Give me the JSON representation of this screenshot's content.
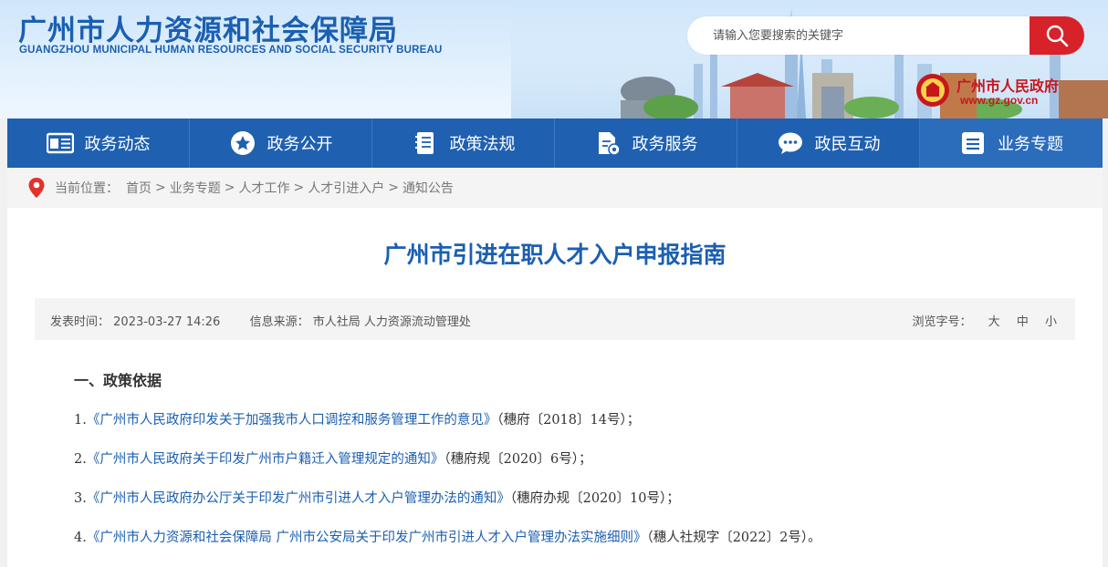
{
  "header": {
    "title": "广州市人力资源和社会保障局",
    "subtitle": "GUANGZHOU MUNICIPAL HUMAN RESOURCES AND SOCIAL SECURITY BUREAU",
    "search_placeholder": "请输入您要搜索的关键字",
    "gov_name": "广州市人民政府",
    "gov_url": "www.gz.gov.cn"
  },
  "nav": {
    "items": [
      {
        "label": "政务动态",
        "icon": "newspaper-icon"
      },
      {
        "label": "政务公开",
        "icon": "star-icon"
      },
      {
        "label": "政策法规",
        "icon": "document-icon"
      },
      {
        "label": "政务服务",
        "icon": "service-icon"
      },
      {
        "label": "政民互动",
        "icon": "chat-icon"
      },
      {
        "label": "业务专题",
        "icon": "menu-icon"
      }
    ]
  },
  "breadcrumb": {
    "prefix": "当前位置：",
    "items": [
      "首页",
      "业务专题",
      "人才工作",
      "人才引进入户",
      "通知公告"
    ]
  },
  "article": {
    "title": "广州市引进在职人才入户申报指南",
    "publish_label": "发表时间：",
    "publish_time": "2023-03-27 14:26",
    "source_label": "信息来源：",
    "source": "市人社局 人力资源流动管理处",
    "font_size_label": "浏览字号：",
    "font_sizes": [
      "大",
      "中",
      "小"
    ],
    "section_heading": "一、政策依据",
    "policies": [
      {
        "num": "1.",
        "link": "《广州市人民政府印发关于加强我市人口调控和服务管理工作的意见》",
        "suffix": "（穗府〔2018〕14号）；"
      },
      {
        "num": "2.",
        "link": "《广州市人民政府关于印发广州市户籍迁入管理规定的通知》",
        "suffix": "（穗府规〔2020〕6号）；"
      },
      {
        "num": "3.",
        "link": "《广州市人民政府办公厅关于印发广州市引进人才入户管理办法的通知》",
        "suffix": "（穗府办规〔2020〕10号）；"
      },
      {
        "num": "4.",
        "link": "《广州市人力资源和社会保障局 广州市公安局关于印发广州市引进人才入户管理办法实施细则》",
        "suffix": "（穗人社规字〔2022〕2号）。"
      }
    ]
  },
  "colors": {
    "brand_blue": "#1f60b0",
    "title_blue": "#1b5fb1",
    "accent_red": "#d7222a"
  }
}
